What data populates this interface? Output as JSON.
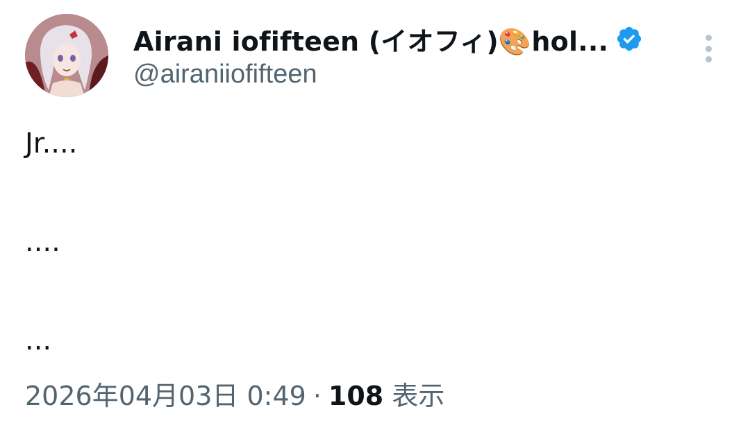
{
  "user": {
    "display_name": "Airani iofifteen (イオフィ)🎨hol...",
    "handle": "@airaniiofifteen",
    "verified_color": "#1d9bf0",
    "avatar_icon": "anime-character-avatar"
  },
  "more_icon": "more-vertical-icon",
  "tweet": {
    "lines": [
      "Jr....",
      "....",
      "..."
    ]
  },
  "meta": {
    "timestamp": "2026年04月03日 0:49",
    "separator": "·",
    "views_count": "108",
    "views_label": "表示"
  }
}
